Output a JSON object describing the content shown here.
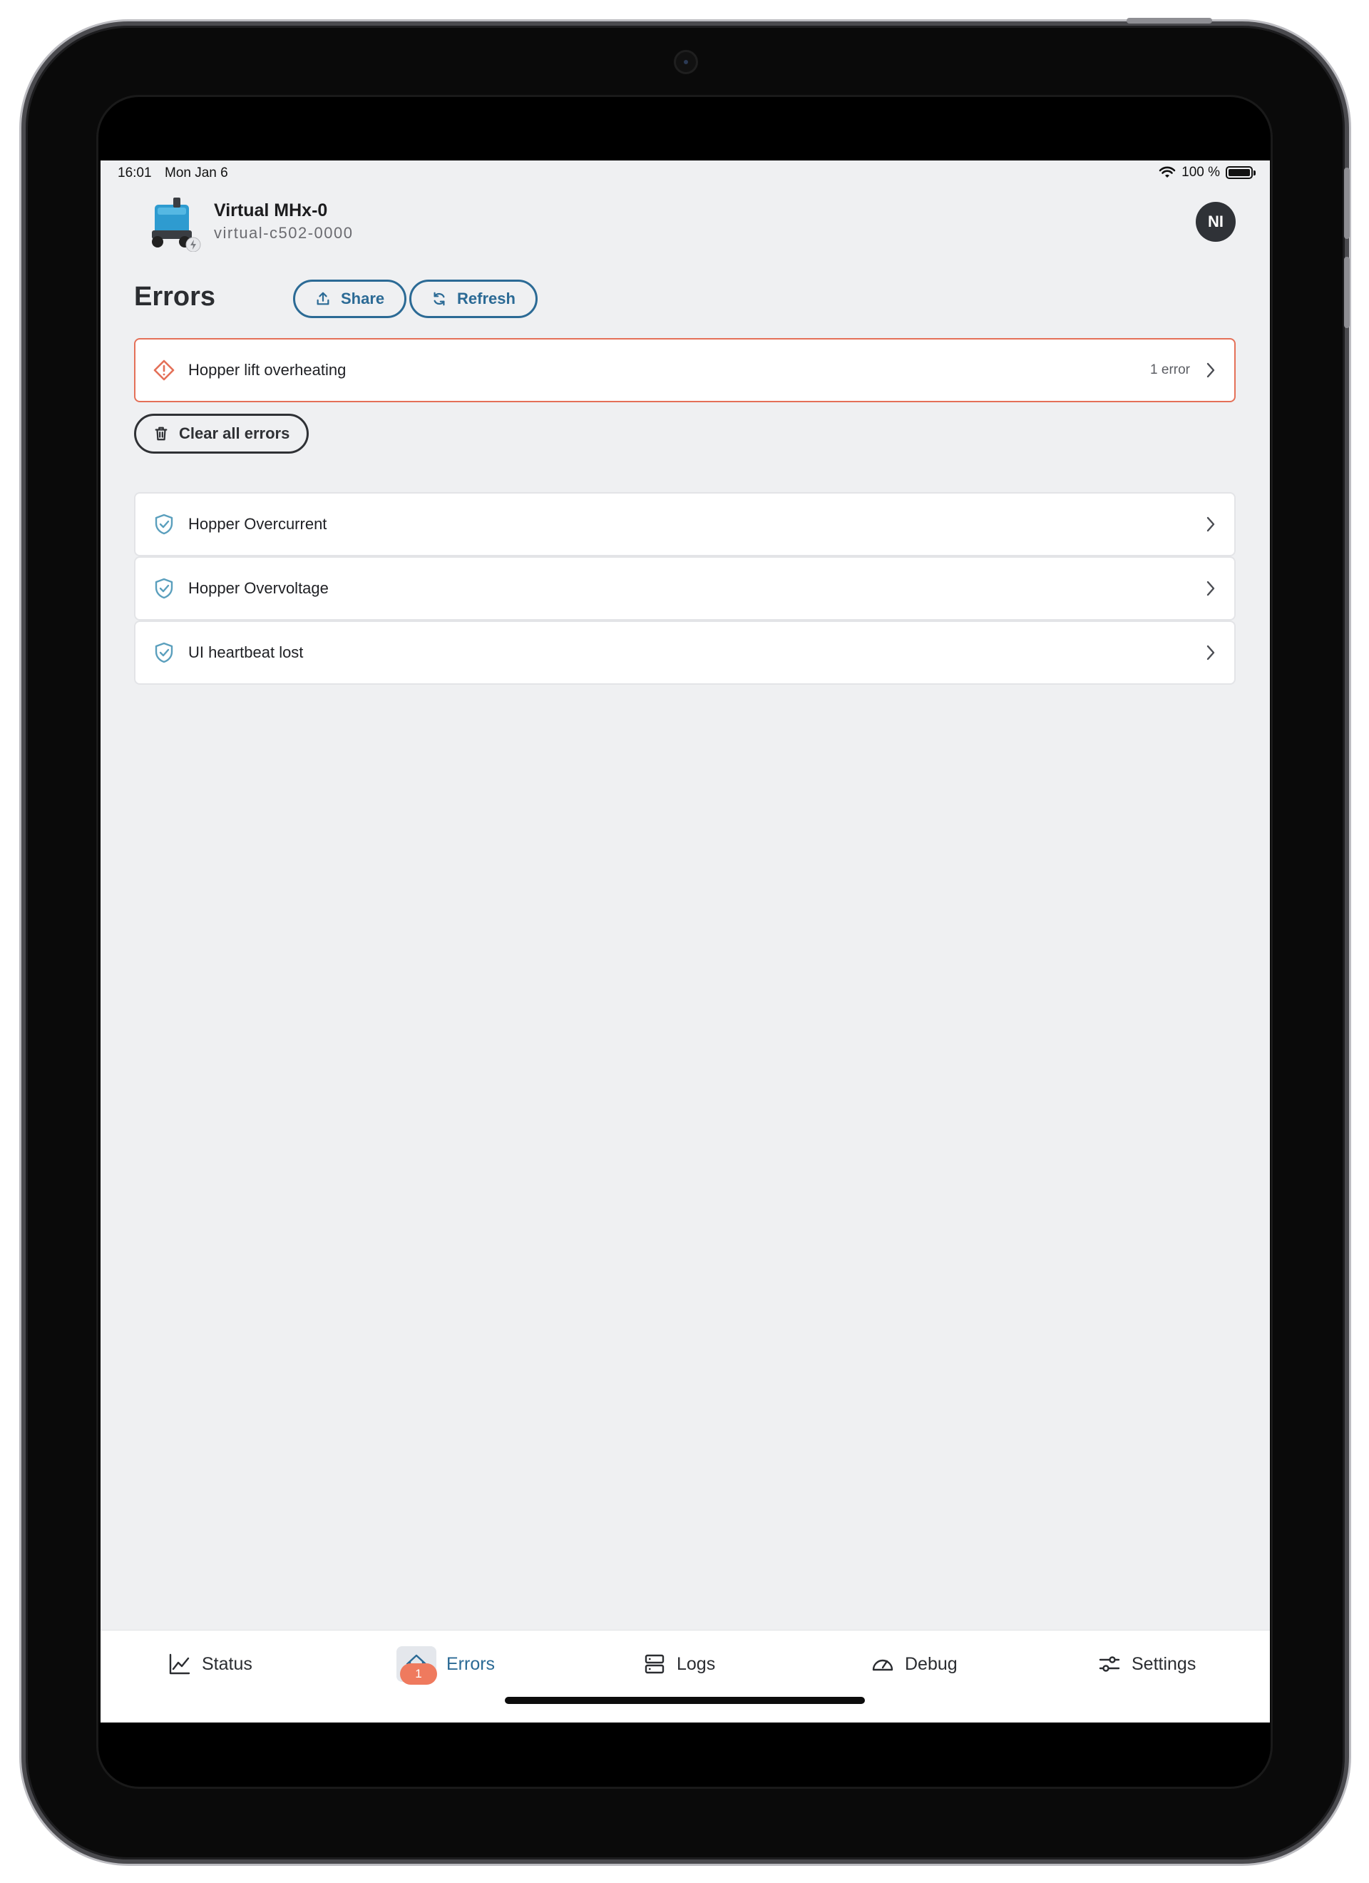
{
  "status_bar": {
    "time": "16:01",
    "date": "Mon Jan 6",
    "battery": "100 %"
  },
  "header": {
    "machine_name": "Virtual MHx-0",
    "machine_id": "virtual-c502-0000",
    "avatar_initials": "NI"
  },
  "page": {
    "title": "Errors",
    "share_label": "Share",
    "refresh_label": "Refresh",
    "clear_label": "Clear all errors"
  },
  "active_errors": [
    {
      "label": "Hopper lift overheating",
      "count": "1 error",
      "icon": "warning-diamond-icon"
    }
  ],
  "resolved_errors": [
    {
      "label": "Hopper Overcurrent",
      "icon": "shield-check-icon"
    },
    {
      "label": "Hopper Overvoltage",
      "icon": "shield-check-icon"
    },
    {
      "label": "UI heartbeat lost",
      "icon": "shield-check-icon"
    }
  ],
  "tabs": [
    {
      "label": "Status",
      "icon": "chart-line-icon"
    },
    {
      "label": "Errors",
      "icon": "home-alert-icon",
      "badge": "1",
      "active": true
    },
    {
      "label": "Logs",
      "icon": "server-icon"
    },
    {
      "label": "Debug",
      "icon": "gauge-icon"
    },
    {
      "label": "Settings",
      "icon": "sliders-icon"
    }
  ],
  "colors": {
    "accent": "#2b6a95",
    "error": "#e47058",
    "badge": "#ef7a5e",
    "resolved_icon": "#5a9fbd",
    "background": "#eff0f2"
  }
}
